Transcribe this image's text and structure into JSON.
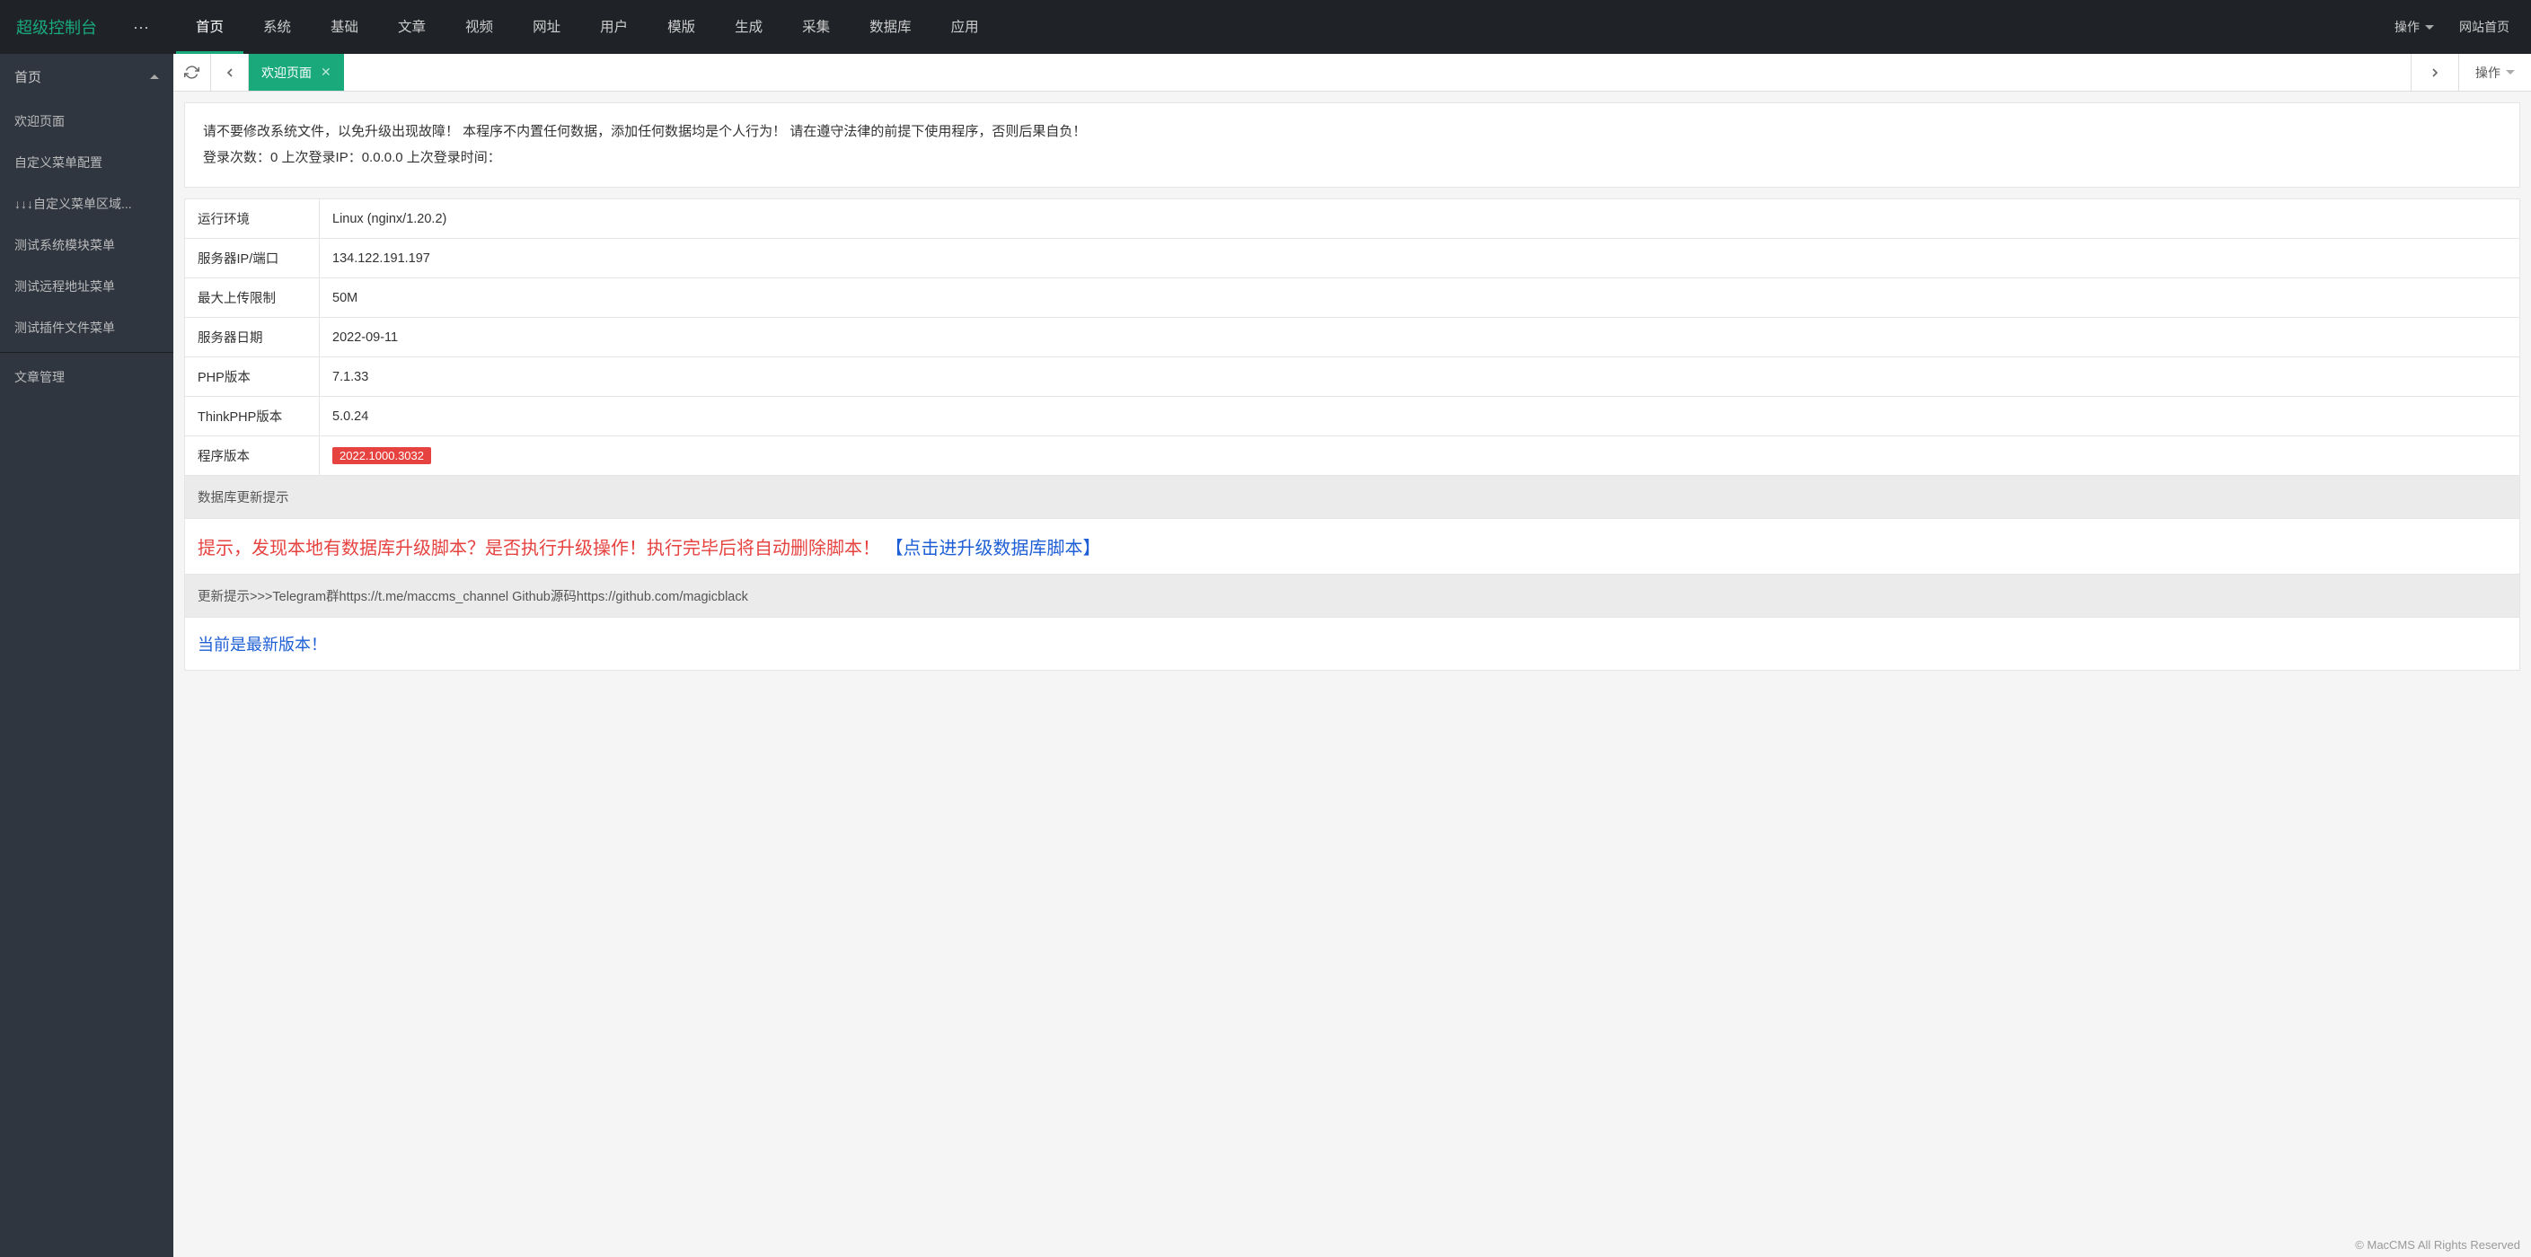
{
  "header": {
    "logo": "超级控制台",
    "nav": [
      "首页",
      "系统",
      "基础",
      "文章",
      "视频",
      "网址",
      "用户",
      "模版",
      "生成",
      "采集",
      "数据库",
      "应用"
    ],
    "active_nav": 0,
    "right": {
      "action": "操作",
      "site_home": "网站首页"
    }
  },
  "sidebar": {
    "header": "首页",
    "items": [
      "欢迎页面",
      "自定义菜单配置",
      "↓↓↓自定义菜单区域...",
      "测试系统模块菜单",
      "测试远程地址菜单",
      "测试插件文件菜单"
    ],
    "bottom_items": [
      "文章管理"
    ]
  },
  "tabbar": {
    "tabs": [
      {
        "label": "欢迎页面"
      }
    ],
    "right_action": "操作"
  },
  "notice": {
    "line1": "请不要修改系统文件，以免升级出现故障！ 本程序不内置任何数据，添加任何数据均是个人行为！ 请在遵守法律的前提下使用程序，否则后果自负！",
    "login_count_label": "登录次数：",
    "login_count": "0",
    "last_ip_label": " 上次登录IP：",
    "last_ip": "0.0.0.0",
    "last_time_label": " 上次登录时间："
  },
  "info_rows": [
    {
      "label": "运行环境",
      "value": "Linux (nginx/1.20.2)"
    },
    {
      "label": "服务器IP/端口",
      "value": "134.122.191.197"
    },
    {
      "label": "最大上传限制",
      "value": "50M"
    },
    {
      "label": "服务器日期",
      "value": "2022-09-11"
    },
    {
      "label": "PHP版本",
      "value": "7.1.33"
    },
    {
      "label": "ThinkPHP版本",
      "value": "5.0.24"
    },
    {
      "label": "程序版本",
      "value": "2022.1000.3032",
      "badge": true
    }
  ],
  "db_update": {
    "header": "数据库更新提示",
    "warn": "提示，发现本地有数据库升级脚本？是否执行升级操作！执行完毕后将自动删除脚本！ ",
    "link": "【点击进升级数据库脚本】"
  },
  "update_tip": {
    "header": "更新提示>>>Telegram群https://t.me/maccms_channel    Github源码https://github.com/magicblack",
    "body": "当前是最新版本！"
  },
  "footer": "© MacCMS All Rights Reserved"
}
